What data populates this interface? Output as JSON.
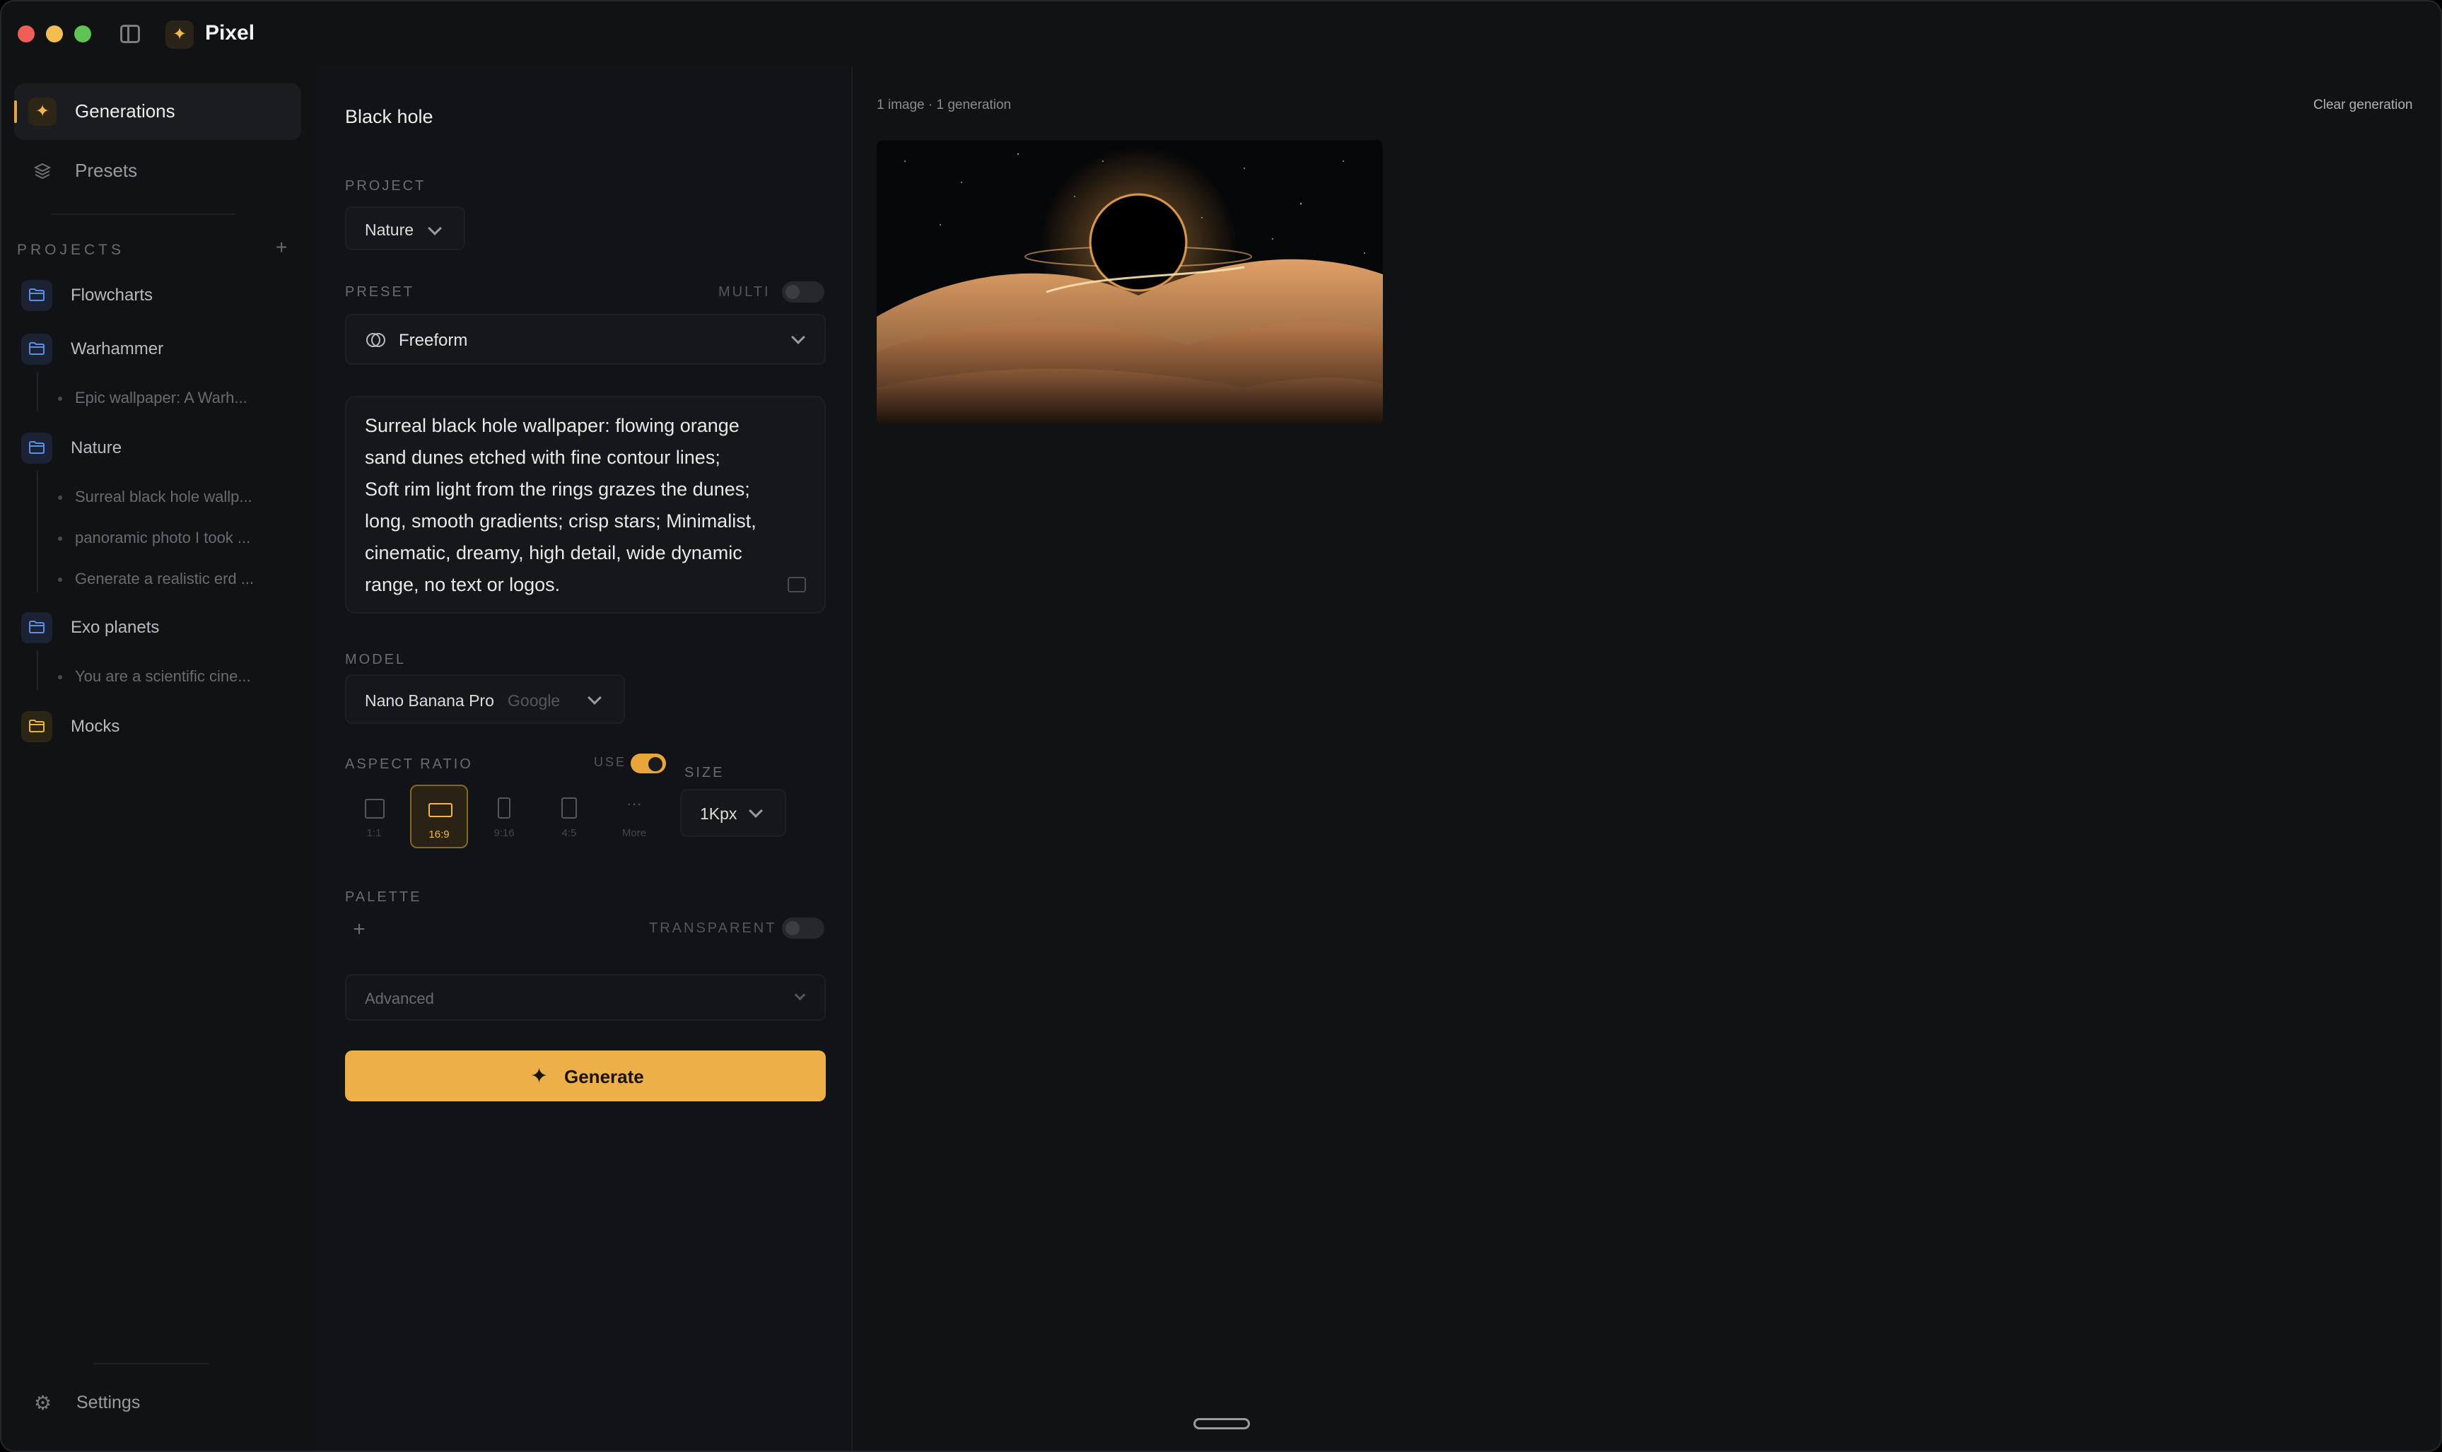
{
  "app": {
    "name": "Pixel"
  },
  "sidebar": {
    "nav": [
      {
        "label": "Generations",
        "icon": "sparkle-icon",
        "active": true
      },
      {
        "label": "Presets",
        "icon": "layers-icon",
        "active": false
      }
    ],
    "projects_heading": "PROJECTS",
    "projects": [
      {
        "label": "Flowcharts",
        "children": []
      },
      {
        "label": "Warhammer",
        "children": [
          "Epic wallpaper: A Warh..."
        ]
      },
      {
        "label": "Nature",
        "children": [
          "Surreal black hole wallp...",
          "panoramic photo I took ...",
          "Generate a realistic erd ..."
        ]
      },
      {
        "label": "Exo planets",
        "children": [
          "You are a scientific cine..."
        ]
      },
      {
        "label": "Mocks",
        "children": []
      }
    ],
    "settings_label": "Settings"
  },
  "form": {
    "title": "Black hole",
    "project_label": "PROJECT",
    "project_value": "Nature",
    "preset_label": "PRESET",
    "multi_label": "MULTI",
    "multi_on": false,
    "preset_value": "Freeform",
    "prompt": "Surreal black hole wallpaper: flowing orange\nsand dunes etched with fine contour lines;\nSoft rim light from the rings grazes the dunes;\nlong, smooth gradients; crisp stars; Minimalist,\ncinematic, dreamy, high detail, wide dynamic\nrange, no text or logos.",
    "model_label": "MODEL",
    "model_name": "Nano Banana Pro",
    "model_provider": "Google",
    "aspect_label": "ASPECT RATIO",
    "use_label": "USE",
    "use_on": true,
    "aspect_options": [
      "1:1",
      "16:9",
      "9:16",
      "4:5",
      "More"
    ],
    "aspect_selected": "16:9",
    "size_label": "SIZE",
    "size_value": "1Kpx",
    "palette_label": "PALETTE",
    "transparent_label": "TRANSPARENT",
    "transparent_on": false,
    "advanced_label": "Advanced",
    "generate_label": "Generate"
  },
  "results": {
    "meta": "1 image · 1 generation",
    "clear_label": "Clear generation"
  },
  "colors": {
    "accent": "#edaf48",
    "background": "#111214",
    "folder_blue": "#5b8ee6",
    "folder_yellow": "#e8b447"
  }
}
